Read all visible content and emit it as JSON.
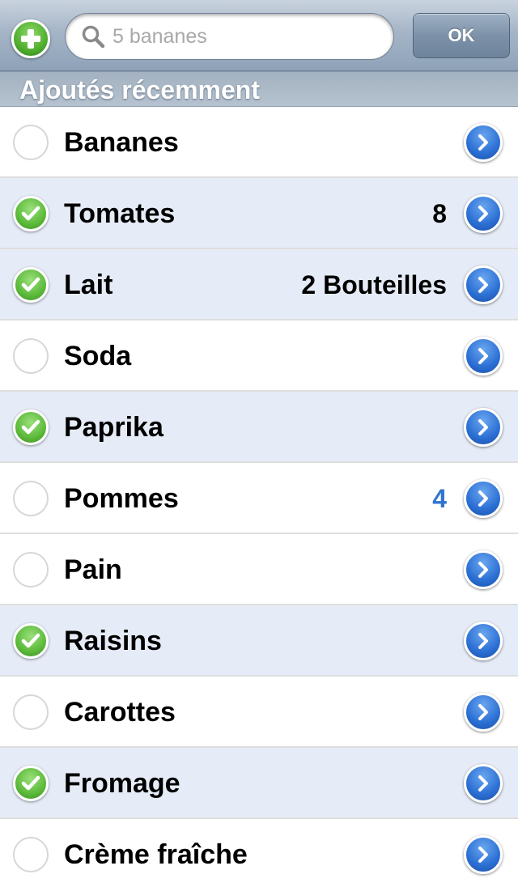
{
  "toolbar": {
    "search_placeholder": "5 bananes",
    "ok_label": "OK"
  },
  "section": {
    "title": "Ajoutés récemment"
  },
  "colors": {
    "accent_blue": "#2f74d0",
    "check_green": "#5cba3a",
    "row_alt": "#e6ecf7"
  },
  "items": [
    {
      "name": "Bananes",
      "qty": "",
      "checked": false,
      "shaded": false,
      "accent": false
    },
    {
      "name": "Tomates",
      "qty": "8",
      "checked": true,
      "shaded": true,
      "accent": false
    },
    {
      "name": "Lait",
      "qty": "2 Bouteilles",
      "checked": true,
      "shaded": true,
      "accent": false
    },
    {
      "name": "Soda",
      "qty": "",
      "checked": false,
      "shaded": false,
      "accent": false
    },
    {
      "name": "Paprika",
      "qty": "",
      "checked": true,
      "shaded": true,
      "accent": false
    },
    {
      "name": "Pommes",
      "qty": "4",
      "checked": false,
      "shaded": false,
      "accent": true
    },
    {
      "name": "Pain",
      "qty": "",
      "checked": false,
      "shaded": false,
      "accent": false
    },
    {
      "name": "Raisins",
      "qty": "",
      "checked": true,
      "shaded": true,
      "accent": false
    },
    {
      "name": "Carottes",
      "qty": "",
      "checked": false,
      "shaded": false,
      "accent": false
    },
    {
      "name": "Fromage",
      "qty": "",
      "checked": true,
      "shaded": true,
      "accent": false
    },
    {
      "name": "Crème fraîche",
      "qty": "",
      "checked": false,
      "shaded": false,
      "accent": false
    }
  ]
}
